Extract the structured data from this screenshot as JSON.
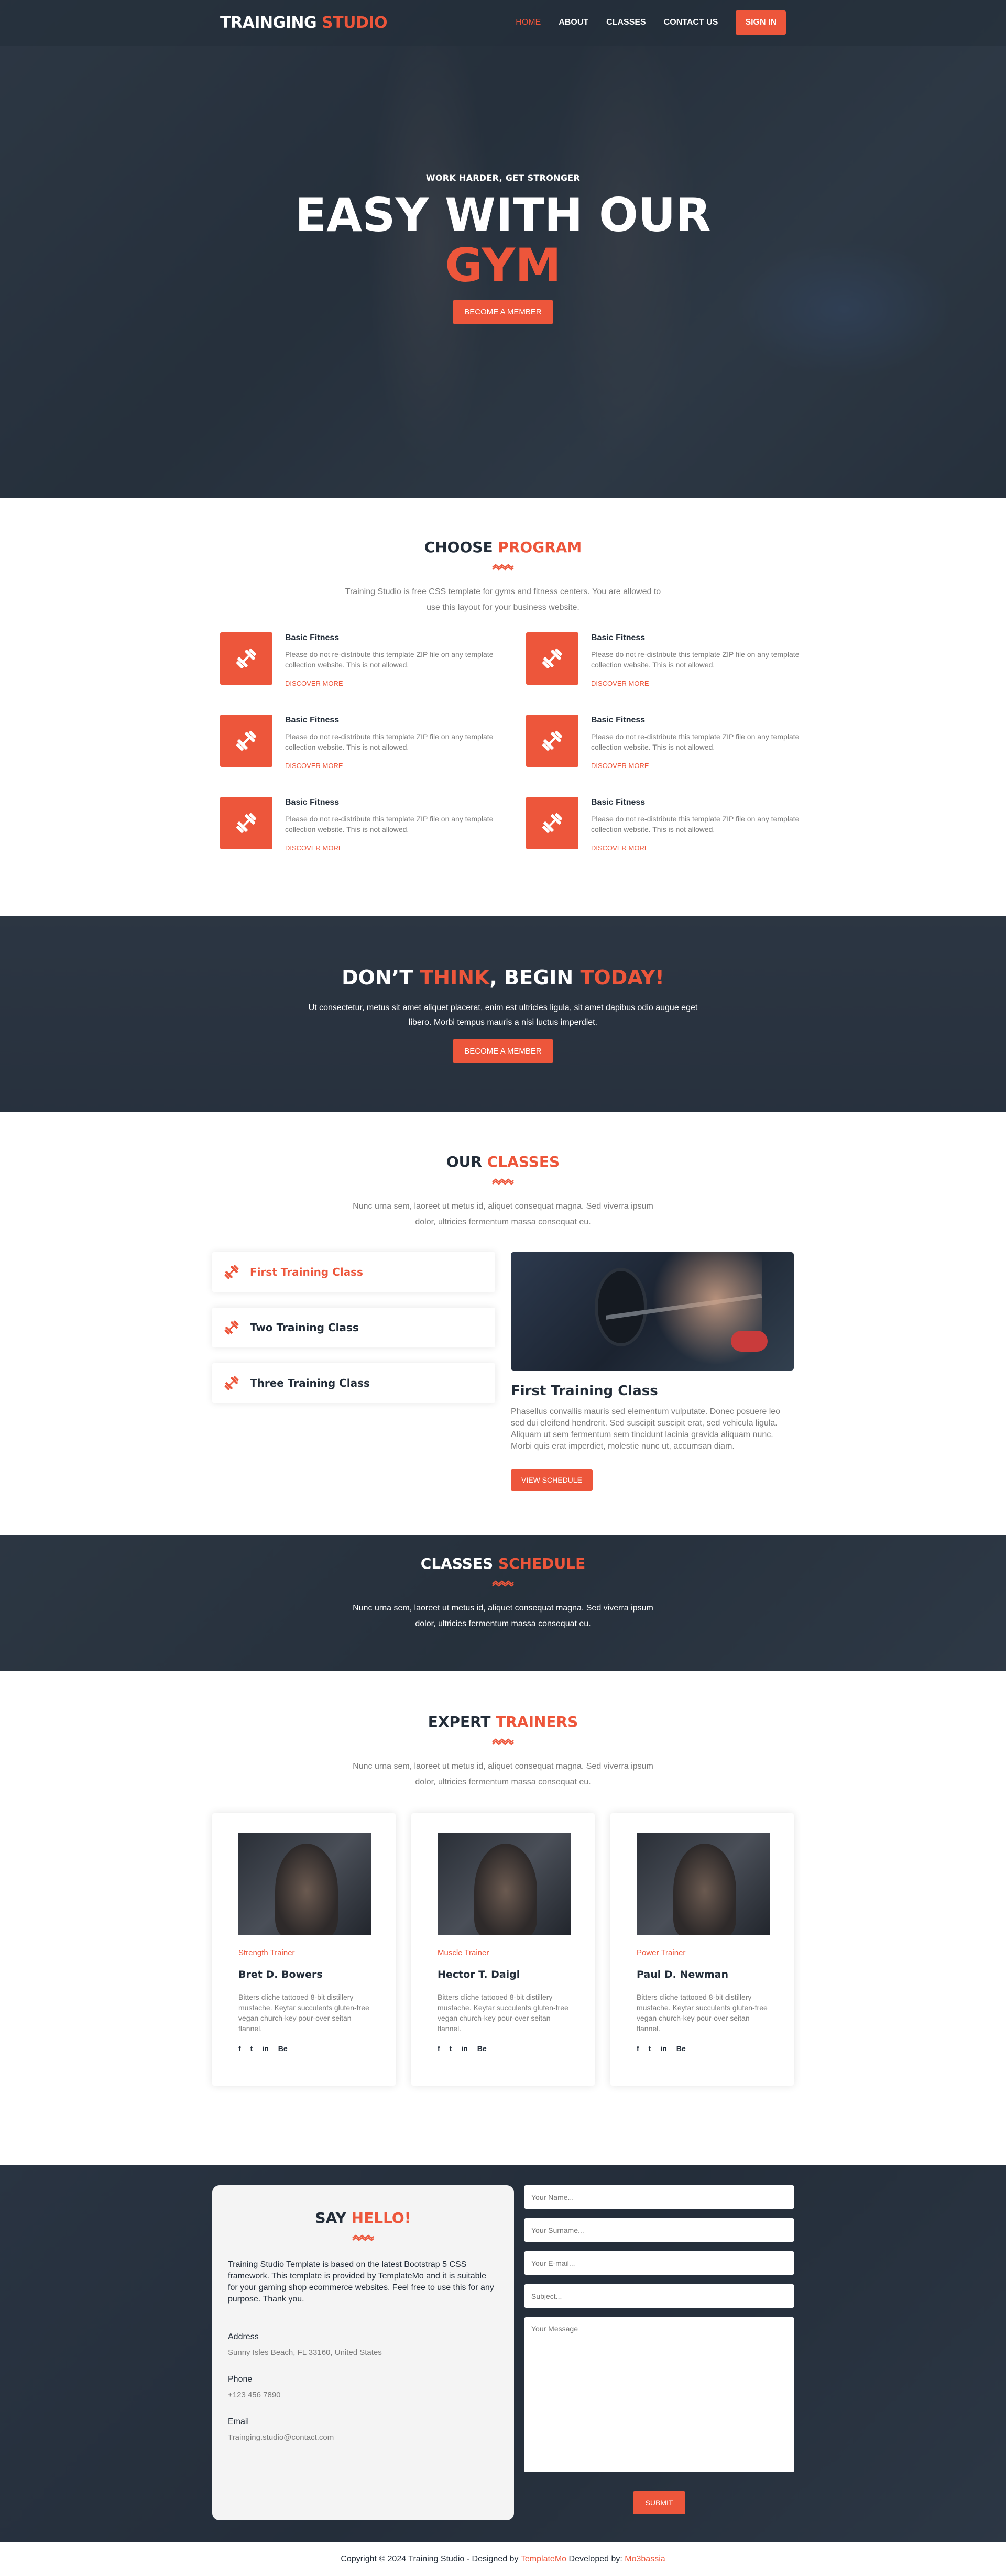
{
  "header": {
    "logo_main": "TRAINGING",
    "logo_accent": "STUDIO",
    "nav": [
      "HOME",
      "ABOUT",
      "CLASSES",
      "CONTACT US"
    ],
    "signin": "SIGN IN"
  },
  "hero": {
    "kicker": "WORK HARDER, GET STRONGER",
    "title_line1": "EASY WITH OUR",
    "title_accent": "GYM",
    "button": "BECOME A MEMBER"
  },
  "program": {
    "title_main": "CHOOSE",
    "title_accent": "PROGRAM",
    "description": "Training Studio is free CSS template for gyms and fitness centers. You are allowed to use this layout for your business website.",
    "items": [
      {
        "title": "Basic Fitness",
        "text": "Please do not re-distribute this template ZIP file on any template collection website. This is not allowed.",
        "link": "DISCOVER MORE"
      },
      {
        "title": "Basic Fitness",
        "text": "Please do not re-distribute this template ZIP file on any template collection website. This is not allowed.",
        "link": "DISCOVER MORE"
      },
      {
        "title": "Basic Fitness",
        "text": "Please do not re-distribute this template ZIP file on any template collection website. This is not allowed.",
        "link": "DISCOVER MORE"
      },
      {
        "title": "Basic Fitness",
        "text": "Please do not re-distribute this template ZIP file on any template collection website. This is not allowed.",
        "link": "DISCOVER MORE"
      },
      {
        "title": "Basic Fitness",
        "text": "Please do not re-distribute this template ZIP file on any template collection website. This is not allowed.",
        "link": "DISCOVER MORE"
      },
      {
        "title": "Basic Fitness",
        "text": "Please do not re-distribute this template ZIP file on any template collection website. This is not allowed.",
        "link": "DISCOVER MORE"
      }
    ]
  },
  "cta": {
    "title_a": "DON’T",
    "title_b": "THINK",
    "title_c": ", BEGIN",
    "title_d": "TODAY!",
    "text": "Ut consectetur, metus sit amet aliquet placerat, enim est ultricies ligula, sit amet dapibus odio augue eget libero. Morbi tempus mauris a nisi luctus imperdiet.",
    "button": "BECOME A MEMBER"
  },
  "classes": {
    "title_main": "OUR",
    "title_accent": "CLASSES",
    "description": "Nunc urna sem, laoreet ut metus id, aliquet consequat magna. Sed viverra ipsum dolor, ultricies fermentum massa consequat eu.",
    "tabs": [
      "First Training Class",
      "Two Training Class",
      "Three Training Class"
    ],
    "detail_title": "First Training Class",
    "detail_text": "Phasellus convallis mauris sed elementum vulputate. Donec posuere leo sed dui eleifend hendrerit. Sed suscipit suscipit erat, sed vehicula ligula. Aliquam ut sem fermentum sem tincidunt lacinia gravida aliquam nunc. Morbi quis erat imperdiet, molestie nunc ut, accumsan diam.",
    "detail_button": "VIEW SCHEDULE"
  },
  "schedule": {
    "title_main": "CLASSES",
    "title_accent": "SCHEDULE",
    "description": "Nunc urna sem, laoreet ut metus id, aliquet consequat magna. Sed viverra ipsum dolor, ultricies fermentum massa consequat eu."
  },
  "trainers": {
    "title_main": "EXPERT",
    "title_accent": "TRAINERS",
    "description": "Nunc urna sem, laoreet ut metus id, aliquet consequat magna. Sed viverra ipsum dolor, ultricies fermentum massa consequat eu.",
    "items": [
      {
        "role": "Strength Trainer",
        "name": "Bret D. Bowers",
        "bio": "Bitters cliche tattooed 8-bit distillery mustache. Keytar succulents gluten-free vegan church-key pour-over seitan flannel."
      },
      {
        "role": "Muscle Trainer",
        "name": "Hector T. Daigl",
        "bio": "Bitters cliche tattooed 8-bit distillery mustache. Keytar succulents gluten-free vegan church-key pour-over seitan flannel."
      },
      {
        "role": "Power Trainer",
        "name": "Paul D. Newman",
        "bio": "Bitters cliche tattooed 8-bit distillery mustache. Keytar succulents gluten-free vegan church-key pour-over seitan flannel."
      }
    ],
    "social": [
      "f",
      "t",
      "in",
      "Be"
    ]
  },
  "contact": {
    "title_main": "SAY",
    "title_accent": "HELLO!",
    "description": "Training Studio Template is based on the latest Bootstrap 5 CSS framework. This template is provided by TemplateMo and it is suitable for your gaming shop ecommerce websites. Feel free to use this for any purpose. Thank you.",
    "address_label": "Address",
    "address_value": "Sunny Isles Beach, FL 33160, United States",
    "phone_label": "Phone",
    "phone_value": "+123 456 7890",
    "email_label": "Email",
    "email_value": "Trainging.studio@contact.com",
    "form": {
      "name_placeholder": "Your Name...",
      "surname_placeholder": "Your Surname...",
      "email_placeholder": "Your E-mail...",
      "subject_placeholder": "Subject...",
      "message_placeholder": "Your Message",
      "submit": "SUBMIT"
    }
  },
  "footer": {
    "copyright": "Copyright © 2024 Training Studio - Designed by",
    "designer": "TemplateMo",
    "dev_label": "Developed by:",
    "developer": "Mo3bassia"
  },
  "colors": {
    "accent": "#ed563b",
    "dark": "#232d39",
    "muted": "#7a7a7a"
  }
}
